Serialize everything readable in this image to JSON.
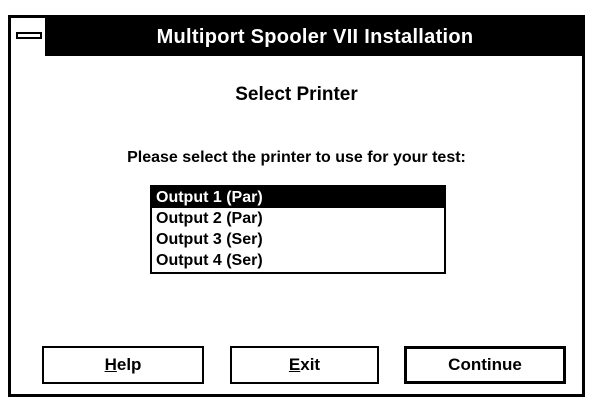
{
  "window": {
    "title": "Multiport Spooler VII Installation"
  },
  "dialog": {
    "heading": "Select Printer",
    "prompt": "Please select the printer to use for your test:"
  },
  "printers": {
    "items": [
      {
        "label": "Output 1 (Par)",
        "selected": true
      },
      {
        "label": "Output 2 (Par)",
        "selected": false
      },
      {
        "label": "Output 3 (Ser)",
        "selected": false
      },
      {
        "label": "Output 4 (Ser)",
        "selected": false
      }
    ]
  },
  "buttons": {
    "help": {
      "mnemonic": "H",
      "rest": "elp"
    },
    "exit": {
      "mnemonic": "E",
      "rest": "xit"
    },
    "continue": {
      "label": "Continue"
    }
  },
  "icons": {
    "system_menu": "system-menu-icon"
  }
}
